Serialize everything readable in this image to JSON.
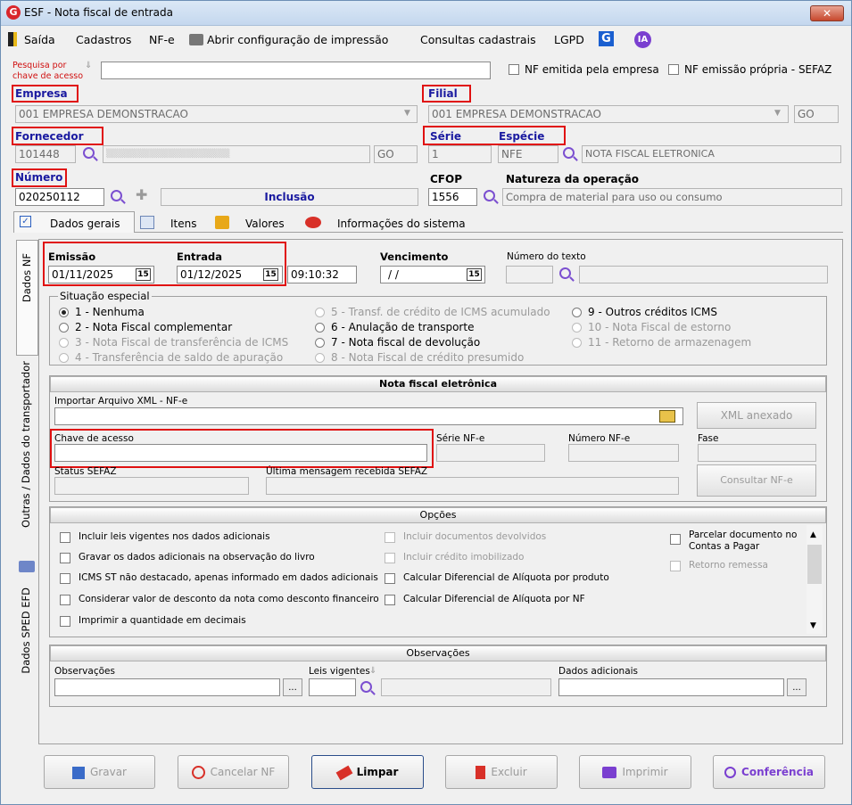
{
  "window": {
    "title": "ESF - Nota fiscal de entrada",
    "close": "✕"
  },
  "menu": {
    "saida": "Saída",
    "cadastros": "Cadastros",
    "nfe": "NF-e",
    "impressao": "Abrir configuração de impressão",
    "consultas": "Consultas cadastrais",
    "lgpd": "LGPD"
  },
  "pesquisa": {
    "label1": "Pesquisa por",
    "label2": "chave de acesso",
    "value": ""
  },
  "flags": {
    "nf_emitida": "NF emitida pela empresa",
    "nf_propria": "NF emissão própria - SEFAZ"
  },
  "empresa": {
    "label": "Empresa",
    "value": "001 EMPRESA DEMONSTRACAO"
  },
  "filial": {
    "label": "Filial",
    "value": "001 EMPRESA DEMONSTRACAO",
    "uf": "GO"
  },
  "fornecedor": {
    "label": "Fornecedor",
    "code": "101448",
    "uf": "GO"
  },
  "serie": {
    "label": "Série",
    "value": "1"
  },
  "especie": {
    "label": "Espécie",
    "value": "NFE",
    "desc": "NOTA FISCAL ELETRONICA"
  },
  "numero": {
    "label": "Número",
    "value": "020250112",
    "status": "Inclusão"
  },
  "cfop": {
    "label": "CFOP",
    "value": "1556"
  },
  "natureza": {
    "label": "Natureza da operação",
    "value": "Compra de material para uso ou consumo"
  },
  "tabs": {
    "dados_gerais": "Dados gerais",
    "itens": "Itens",
    "valores": "Valores",
    "info": "Informações do sistema"
  },
  "vtabs": {
    "dados_nf": "Dados NF",
    "outras": "Outras / Dados do transportador",
    "sped": "Dados SPED EFD"
  },
  "datas": {
    "emissao_label": "Emissão",
    "emissao": "01/11/2025",
    "entrada_label": "Entrada",
    "entrada": "01/12/2025",
    "hora": "09:10:32",
    "venc_label": "Vencimento",
    "venc": "/ /",
    "num_texto": "Número do texto",
    "cal": "15"
  },
  "situacao": {
    "title": "Situação especial",
    "items": [
      "1 - Nenhuma",
      "2 - Nota Fiscal complementar",
      "3 - Nota Fiscal de transferência de ICMS",
      "4 - Transferência de saldo de apuração",
      "5 - Transf. de crédito de ICMS acumulado",
      "6 - Anulação de transporte",
      "7 - Nota fiscal de devolução",
      "8 - Nota Fiscal de crédito presumido",
      "9 - Outros créditos ICMS",
      "10 - Nota Fiscal de estorno",
      "11 - Retorno de armazenagem"
    ]
  },
  "nfe": {
    "title": "Nota fiscal eletrônica",
    "importar": "Importar Arquivo XML - NF-e",
    "xml_btn": "XML anexado",
    "chave": "Chave de acesso",
    "serie": "Série NF-e",
    "numero": "Número NF-e",
    "fase": "Fase",
    "status": "Status SEFAZ",
    "ultima": "Última mensagem recebida SEFAZ",
    "consultar": "Consultar NF-e"
  },
  "opcoes": {
    "title": "Opções",
    "items": [
      "Incluir leis vigentes nos dados adicionais",
      "Gravar os dados adicionais na observação do livro",
      "ICMS ST não destacado, apenas informado em dados adicionais",
      "Considerar valor de desconto da nota como desconto financeiro",
      "Imprimir a quantidade em decimais",
      "Incluir documentos devolvidos",
      "Incluir crédito imobilizado",
      "Calcular Diferencial de Alíquota por produto",
      "Calcular Diferencial de Alíquota por NF",
      "Parcelar documento no",
      "Contas a Pagar",
      "Retorno remessa"
    ]
  },
  "obs": {
    "title": "Observações",
    "observacoes": "Observações",
    "leis": "Leis vigentes",
    "dados": "Dados adicionais",
    "dots": "..."
  },
  "buttons": {
    "gravar": "Gravar",
    "cancelar": "Cancelar NF",
    "limpar": "Limpar",
    "excluir": "Excluir",
    "imprimir": "Imprimir",
    "conferencia": "Conferência"
  }
}
